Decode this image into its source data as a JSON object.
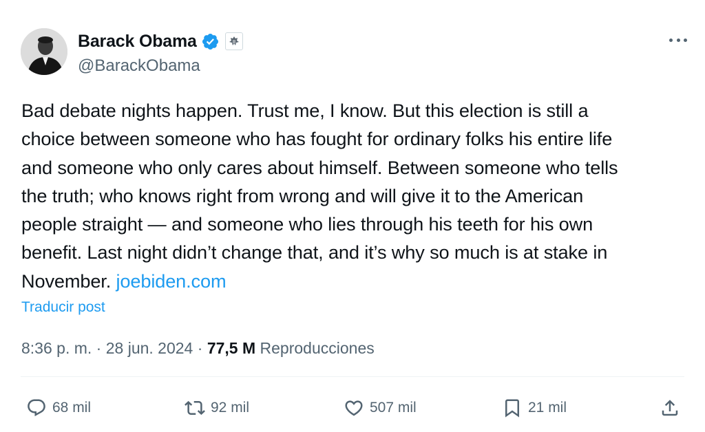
{
  "author": {
    "display_name": "Barack Obama",
    "handle": "@BarackObama",
    "verified_icon": "verified-badge-icon",
    "affiliate_icon": "government-seal-icon"
  },
  "tweet": {
    "lines": [
      "Bad debate nights happen. Trust me, I know. But this election is still a",
      "choice between someone who has fought for ordinary folks his entire life",
      "and someone who only cares about himself. Between someone who tells",
      "the truth; who knows right from wrong and will give it to the American",
      "people straight — and someone who lies through his teeth for his own",
      "benefit. Last night didn’t change that, and it’s why so much is at stake in",
      "November. "
    ],
    "link_text": "joebiden.com",
    "translate_label": "Traducir post"
  },
  "meta": {
    "time": "8:36 p. m.",
    "separator": " · ",
    "date": "28 jun. 2024",
    "views_count": "77,5 M",
    "views_label": " Reproducciones"
  },
  "actions": {
    "reply_count": "68 mil",
    "repost_count": "92 mil",
    "like_count": "507 mil",
    "bookmark_count": "21 mil"
  },
  "colors": {
    "link": "#1d9bf0",
    "secondary_text": "#536471",
    "primary_text": "#0f1419"
  }
}
